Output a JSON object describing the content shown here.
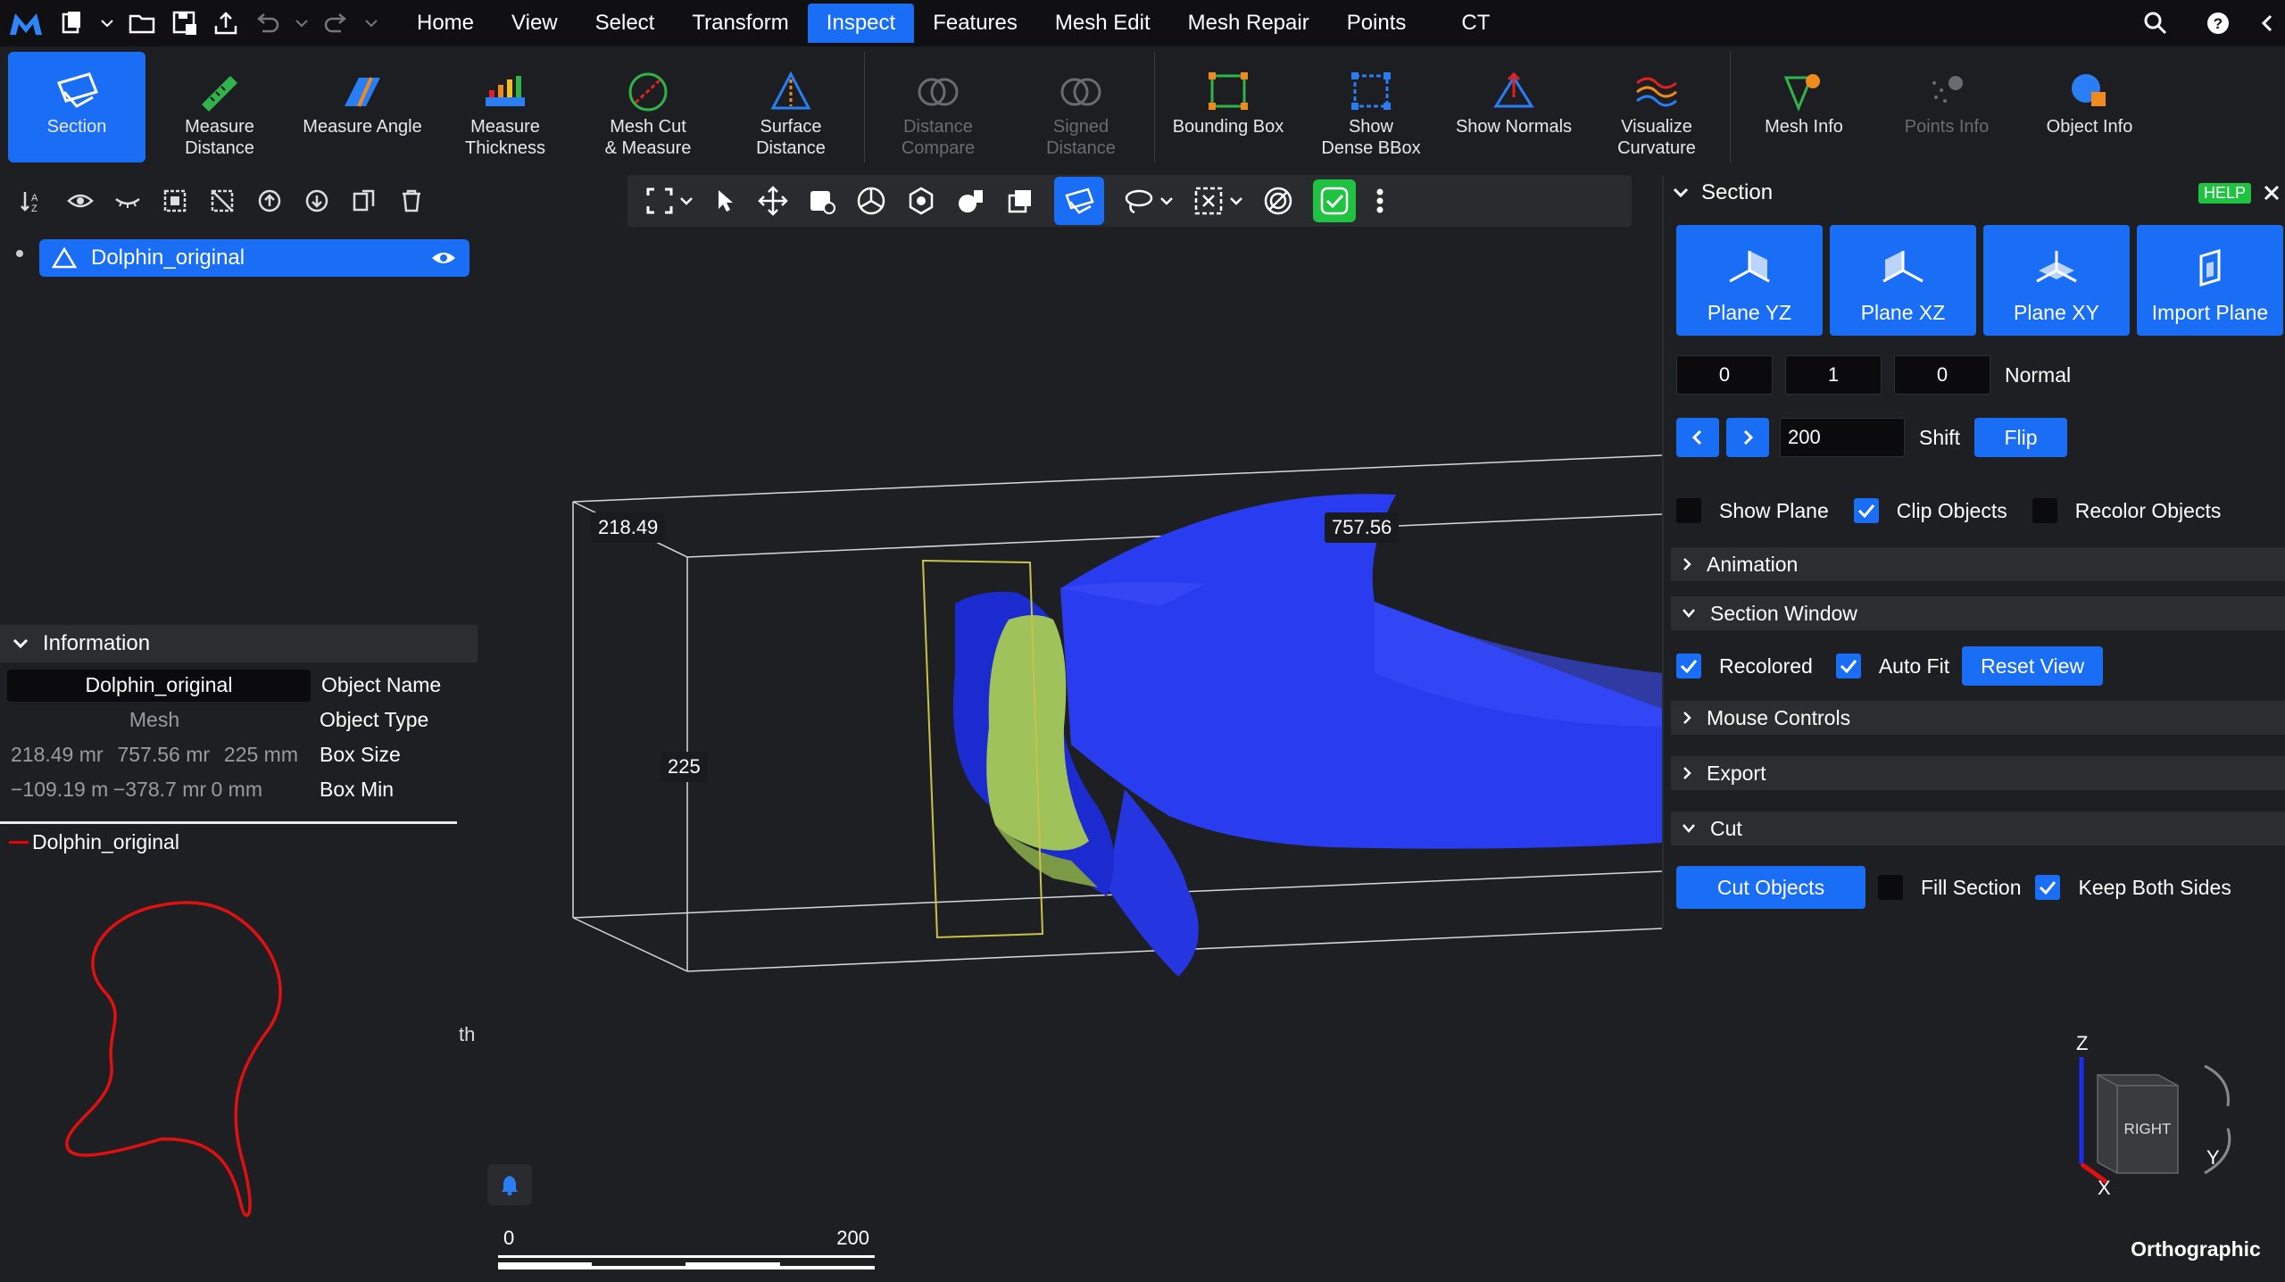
{
  "menu": {
    "tabs": [
      "Home",
      "View",
      "Select",
      "Transform",
      "Inspect",
      "Features",
      "Mesh Edit",
      "Mesh Repair",
      "Points",
      "CT"
    ],
    "active": "Inspect"
  },
  "ribbon": {
    "buttons": [
      {
        "label": "Section",
        "icon": "section-icon",
        "state": "active"
      },
      {
        "label": "Measure\nDistance",
        "icon": "ruler-icon",
        "state": "normal"
      },
      {
        "label": "Measure Angle",
        "icon": "angle-icon",
        "state": "normal"
      },
      {
        "label": "Measure\nThickness",
        "icon": "thickness-icon",
        "state": "normal"
      },
      {
        "label": "Mesh Cut\n& Measure",
        "icon": "mesh-cut-icon",
        "state": "normal"
      },
      {
        "label": "Surface\nDistance",
        "icon": "surface-distance-icon",
        "state": "normal"
      },
      {
        "label": "Distance\nCompare",
        "icon": "distance-compare-icon",
        "state": "disabled"
      },
      {
        "label": "Signed\nDistance",
        "icon": "signed-distance-icon",
        "state": "disabled"
      },
      {
        "label": "Bounding Box",
        "icon": "bounding-box-icon",
        "state": "normal"
      },
      {
        "label": "Show\nDense BBox",
        "icon": "dense-bbox-icon",
        "state": "normal"
      },
      {
        "label": "Show Normals",
        "icon": "normals-icon",
        "state": "normal"
      },
      {
        "label": "Visualize\nCurvature",
        "icon": "curvature-icon",
        "state": "normal"
      },
      {
        "label": "Mesh Info",
        "icon": "mesh-info-icon",
        "state": "normal"
      },
      {
        "label": "Points Info",
        "icon": "points-info-icon",
        "state": "disabled"
      },
      {
        "label": "Object Info",
        "icon": "object-info-icon",
        "state": "normal"
      }
    ]
  },
  "scene": {
    "object_name": "Dolphin_original"
  },
  "information": {
    "header": "Information",
    "object_name_value": "Dolphin_original",
    "object_name_key": "Object Name",
    "object_type_value": "Mesh",
    "object_type_key": "Object Type",
    "box_size": [
      "218.49 mr",
      "757.56 mr",
      "225 mm"
    ],
    "box_size_key": "Box Size",
    "box_min": [
      "−109.19 m",
      "−378.7 mr",
      "0 mm"
    ],
    "box_min_key": "Box Min"
  },
  "contour": {
    "legend": "Dolphin_original",
    "stray_text": "th"
  },
  "viewport": {
    "label_x": "218.49",
    "label_y": "757.56",
    "label_z": "225",
    "scale_start": "0",
    "scale_end": "200",
    "projection": "Orthographic",
    "axis_z": "Z",
    "axis_y": "Y",
    "axis_x": "X",
    "cube_face": "RIGHT"
  },
  "section_panel": {
    "title": "Section",
    "help": "HELP",
    "planes": [
      "Plane YZ",
      "Plane XZ",
      "Plane XY",
      "Import Plane"
    ],
    "normal": [
      "0",
      "1",
      "0"
    ],
    "normal_label": "Normal",
    "shift_value": "200",
    "shift_label": "Shift",
    "flip": "Flip",
    "show_plane": "Show Plane",
    "clip_objects": "Clip Objects",
    "recolor_objects": "Recolor Objects",
    "animation": "Animation",
    "section_window": "Section Window",
    "recolored": "Recolored",
    "auto_fit": "Auto Fit",
    "reset_view": "Reset View",
    "mouse_controls": "Mouse Controls",
    "export": "Export",
    "cut": "Cut",
    "cut_objects": "Cut Objects",
    "fill_section": "Fill Section",
    "keep_both_sides": "Keep Both Sides",
    "checks": {
      "show_plane": false,
      "clip_objects": true,
      "recolor_objects": false,
      "recolored": true,
      "auto_fit": true,
      "fill_section": false,
      "keep_both_sides": true
    }
  },
  "colors": {
    "accent": "#1a6ef5",
    "mesh": "#2a3cf0",
    "section_fill": "#9fc25a",
    "contour": "#e01010",
    "success": "#1fc341"
  }
}
